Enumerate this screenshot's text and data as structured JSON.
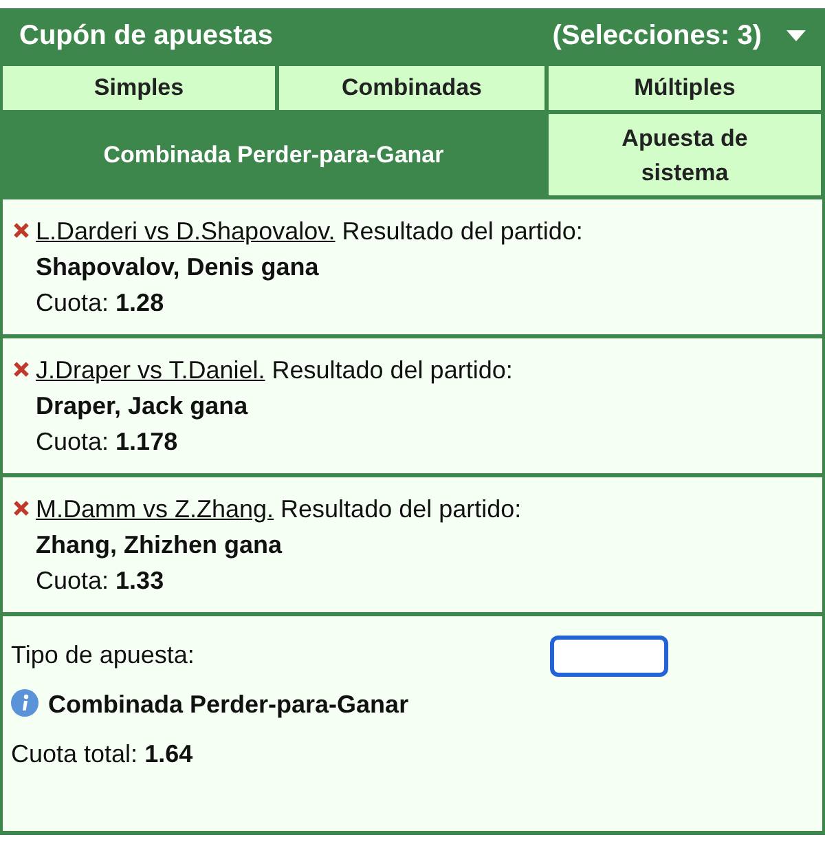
{
  "header": {
    "title": "Cupón de apuestas",
    "count": "(Selecciones: 3)",
    "expanded": true
  },
  "tabs": [
    {
      "label": "Simples",
      "selected": false
    },
    {
      "label": "Combinadas",
      "selected": false
    },
    {
      "label": "Múltiples",
      "selected": false
    },
    {
      "label": "Combinada Perder-para-Ganar",
      "selected": true
    },
    {
      "label": "Apuesta de sistema",
      "selected": false
    }
  ],
  "selections": [
    {
      "match": "L.Darderi vs D.Shapovalov.",
      "market": "Resultado del partido:",
      "pick": "Shapovalov, Denis gana",
      "odds": "Cuota: **1.28**"
    },
    {
      "match": "J.Draper vs T.Daniel.",
      "market": "Resultado del partido:",
      "pick": "Draper, Jack gana",
      "odds": "Cuota: **1.178**"
    },
    {
      "match": "M.Damm vs Z.Zhang.",
      "market": "Resultado del partido:",
      "pick": "Zhang, Zhizhen gana",
      "odds": "Cuota: **1.33**"
    }
  ],
  "summary": {
    "bet_type_label": "Tipo de apuesta:",
    "bet_type": "Combinada Perder-para-Ganar",
    "total_odds": "Cuota total: **1.64**",
    "stake": {
      "focused": true
    }
  }
}
